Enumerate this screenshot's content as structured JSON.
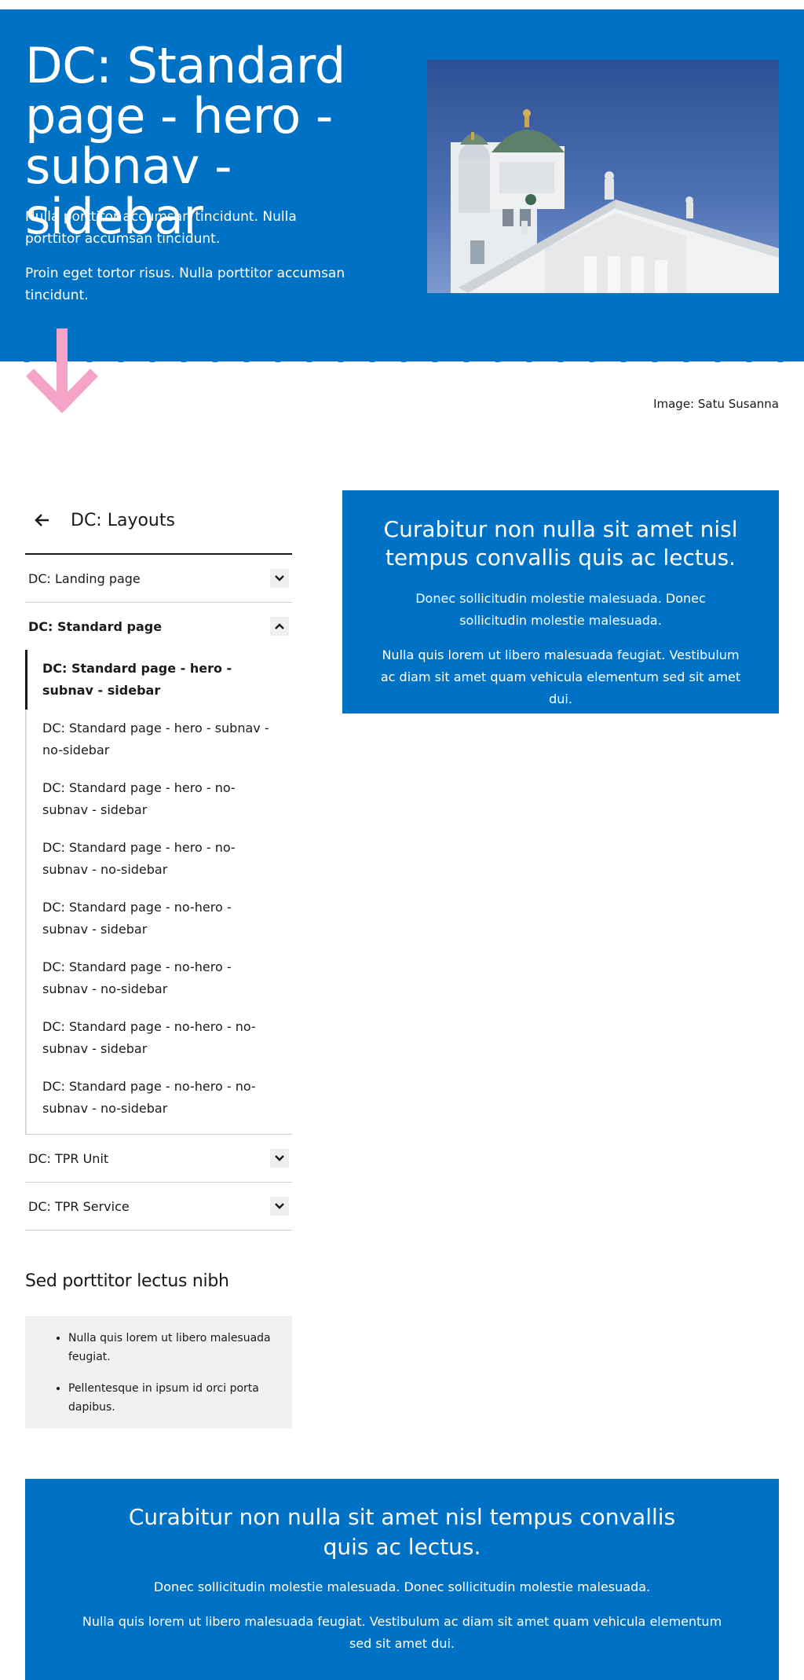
{
  "hero": {
    "title": "DC: Standard page - hero - subnav - sidebar",
    "paragraph_1": "Nulla porttitor accumsan tincidunt. Nulla porttitor accumsan tincidunt.",
    "paragraph_2": "Proin eget tortor risus. Nulla porttitor accumsan tincidunt.",
    "image_credit": "Image: Satu Susanna",
    "background_color": "#0072C6",
    "arrow_color": "#F5A3C7"
  },
  "sidebar": {
    "back_label": "DC: Layouts",
    "items": [
      {
        "label": "DC: Landing page",
        "expanded": false
      },
      {
        "label": "DC: Standard page",
        "expanded": true,
        "children": [
          {
            "label": "DC: Standard page - hero - subnav - sidebar",
            "active": true
          },
          {
            "label": "DC: Standard page - hero - subnav - no-sidebar"
          },
          {
            "label": "DC: Standard page - hero - no-subnav - sidebar"
          },
          {
            "label": "DC: Standard page - hero - no-subnav - no-sidebar"
          },
          {
            "label": "DC: Standard page - no-hero - subnav - sidebar"
          },
          {
            "label": "DC: Standard page - no-hero - subnav - no-sidebar"
          },
          {
            "label": "DC: Standard page - no-hero - no-subnav - sidebar"
          },
          {
            "label": "DC: Standard page - no-hero - no-subnav - no-sidebar"
          }
        ]
      },
      {
        "label": "DC: TPR Unit",
        "expanded": false
      },
      {
        "label": "DC: TPR Service",
        "expanded": false
      }
    ],
    "heading": "Sed porttitor lectus nibh",
    "list": [
      "Nulla quis lorem ut libero malesuada feugiat.",
      "Pellentesque in ipsum id orci porta dapibus."
    ]
  },
  "callout_main": {
    "title": "Curabitur non nulla sit amet nisl tempus convallis quis ac lectus.",
    "paragraph_1": "Donec sollicitudin molestie malesuada. Donec sollicitudin molestie malesuada.",
    "paragraph_2": "Nulla quis lorem ut libero malesuada feugiat. Vestibulum ac diam sit amet quam vehicula elementum sed sit amet dui."
  },
  "callout_bottom": {
    "title": "Curabitur non nulla sit amet nisl tempus convallis quis ac lectus.",
    "paragraph_1": "Donec sollicitudin molestie malesuada. Donec sollicitudin molestie malesuada.",
    "paragraph_2": "Nulla quis lorem ut libero malesuada feugiat. Vestibulum ac diam sit amet quam vehicula elementum sed sit amet dui."
  }
}
